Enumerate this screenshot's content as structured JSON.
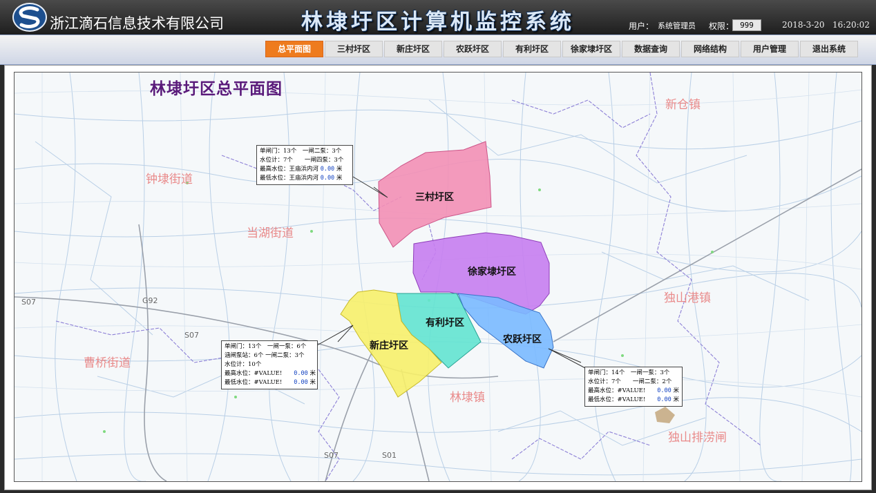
{
  "header": {
    "company": "浙江滴石信息技术有限公司",
    "title": "林埭圩区计算机监控系统",
    "user_label": "用户：",
    "user_name": "系统管理员",
    "perm_label": "权限：",
    "perm_value": "999",
    "date": "2018-3-20",
    "time": "16:20:02"
  },
  "nav": [
    "总平面图",
    "三村圩区",
    "新庄圩区",
    "农跃圩区",
    "有利圩区",
    "徐家埭圩区",
    "数据查询",
    "网络结构",
    "用户管理",
    "退出系统"
  ],
  "map": {
    "title": "林埭圩区总平面图",
    "towns": [
      "新仓镇",
      "钟埭街道",
      "当湖街道",
      "独山港镇",
      "曹桥街道",
      "林埭镇",
      "独山排涝闸"
    ],
    "roads": [
      "S07",
      "G92",
      "S07",
      "S07",
      "S01"
    ],
    "zones": [
      "三村圩区",
      "徐家埭圩区",
      "有利圩区",
      "新庄圩区",
      "农跃圩区"
    ],
    "zone_colors": [
      "#f38fb5",
      "#c77df0",
      "#63e3d0",
      "#f7f06a",
      "#7ab9ff"
    ]
  },
  "info_sancun": {
    "l1": "单闸门：13个　一闸二泵：3个",
    "l2": "水位计：7个　　一闸四泵：3个",
    "l3a": "最高水位：王庙浜内河 ",
    "l3v": "0.00",
    "l3u": " 米",
    "l4a": "最低水位：王庙浜内河 ",
    "l4v": "0.00",
    "l4u": " 米"
  },
  "info_xinzhuang": {
    "l1": "单闸门：13个　一闸一泵：6个",
    "l2": "涵闸泵站：6个 一闸二泵：3个",
    "l3": "水位计：10个",
    "l4a": "最高水位：#VALUE!　　",
    "l4v": "0.00",
    "l4u": " 米",
    "l5a": "最低水位：#VALUE!　　",
    "l5v": "0.00",
    "l5u": " 米"
  },
  "info_nongyue": {
    "l1": "单闸门：14个　一闸一泵：3个",
    "l2": "水位计：7个　　一闸二泵：2个",
    "l3a": "最高水位：#VALUE!　　",
    "l3v": "0.00",
    "l3u": " 米",
    "l4a": "最低水位：#VALUE!　　",
    "l4v": "0.00",
    "l4u": " 米"
  }
}
